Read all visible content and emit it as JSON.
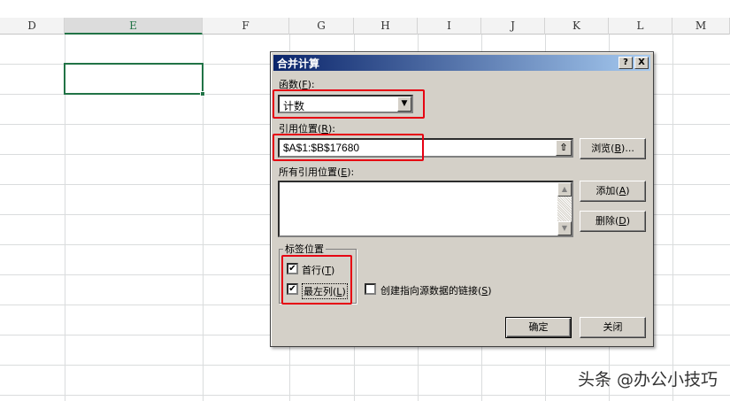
{
  "sheet": {
    "columns": [
      "D",
      "E",
      "F",
      "G",
      "H",
      "I",
      "J",
      "K",
      "L",
      "M"
    ],
    "selected_column": "E"
  },
  "dialog": {
    "title": "合并计算",
    "help_button": "?",
    "close_button": "X",
    "function_label": "函数(",
    "function_accel": "F",
    "function_label_end": "):",
    "function_value": "计数",
    "ref_label": "引用位置(",
    "ref_accel": "R",
    "ref_label_end": "):",
    "ref_value": "$A$1:$B$17680",
    "browse_label": "浏览(",
    "browse_accel": "B",
    "browse_label_end": ")...",
    "all_refs_label": "所有引用位置(",
    "all_refs_accel": "E",
    "all_refs_label_end": "):",
    "add_label": "添加(",
    "add_accel": "A",
    "add_label_end": ")",
    "delete_label": "删除(",
    "delete_accel": "D",
    "delete_label_end": ")",
    "tag_group_label": "标签位置",
    "top_row": {
      "label": "首行(",
      "accel": "T",
      "label_end": ")",
      "checked": true,
      "mark": "✔"
    },
    "left_col": {
      "label": "最左列(",
      "accel": "L",
      "label_end": ")",
      "checked": true,
      "mark": "✔"
    },
    "link_source": {
      "label": "创建指向源数据的链接(",
      "accel": "S",
      "label_end": ")",
      "checked": false
    },
    "ok_label": "确定",
    "close_label": "关闭"
  },
  "watermark": "头条 @办公小技巧",
  "colors": {
    "highlight": "#e60012",
    "dialog_bg": "#d4d0c8",
    "title_start": "#0a246a",
    "excel_green": "#217346"
  }
}
